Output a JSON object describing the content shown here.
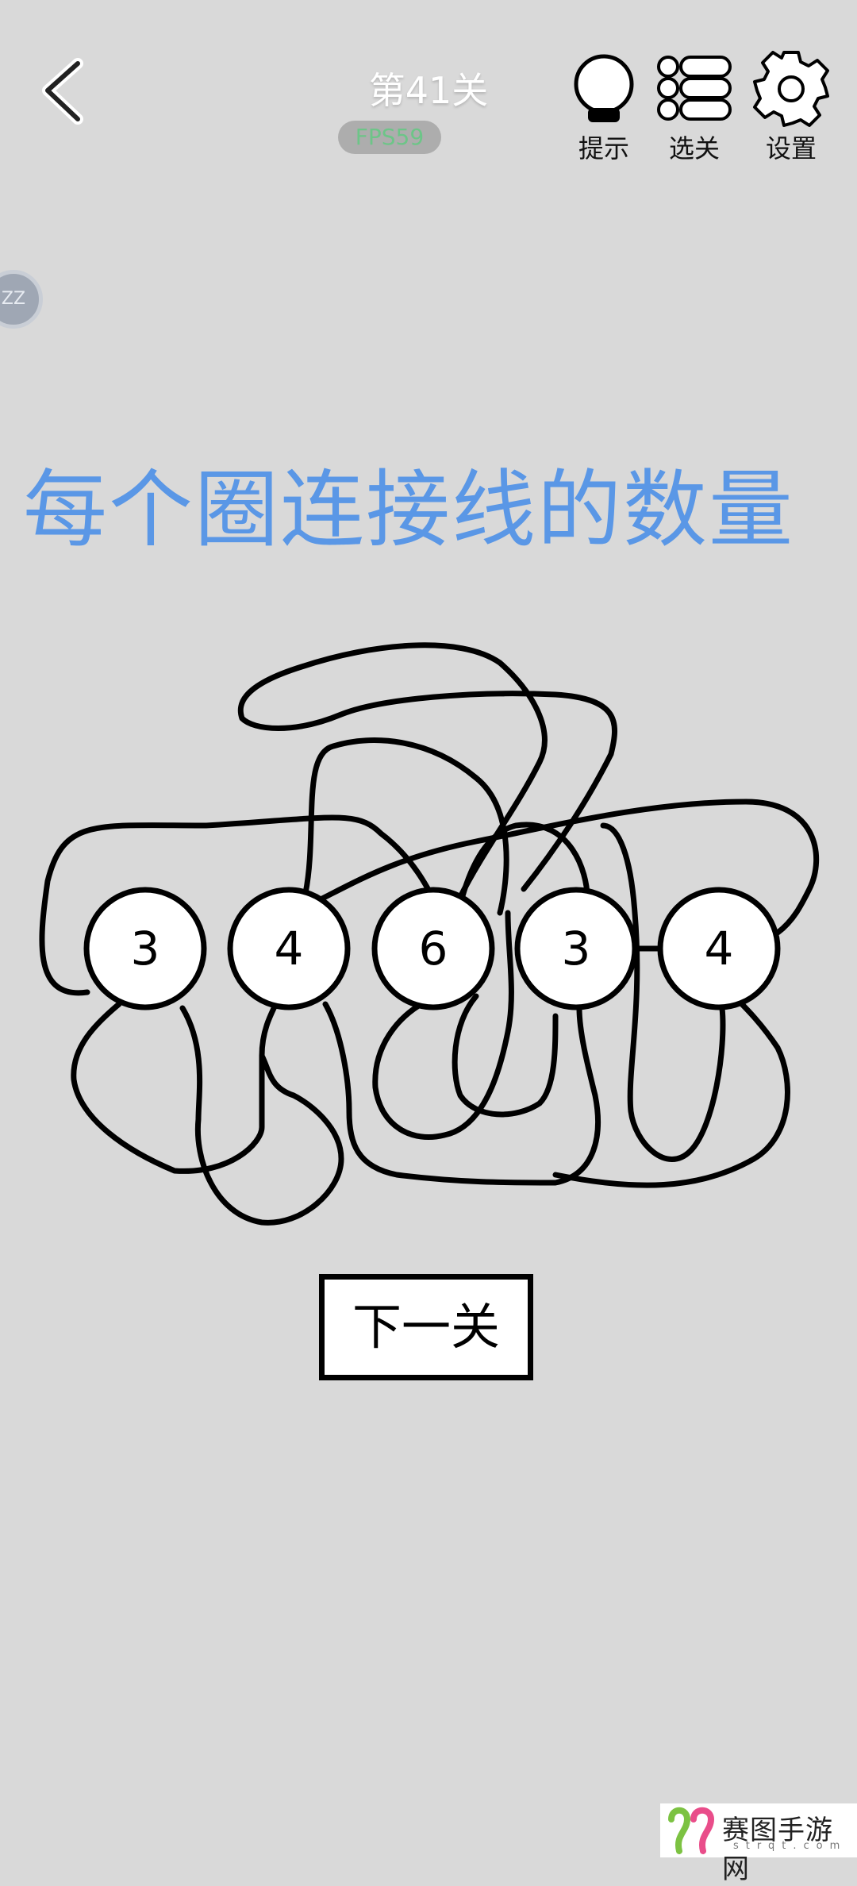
{
  "header": {
    "level_title": "第41关",
    "fps": "FPS59",
    "hint_label": "提示",
    "levels_label": "选关",
    "settings_label": "设置"
  },
  "side_bubble": "ZZ",
  "puzzle": {
    "title": "每个圈连接线的数量",
    "circles": [
      "3",
      "4",
      "6",
      "3",
      "4"
    ]
  },
  "next_button": "下一关",
  "watermark": {
    "text": "赛图手游网",
    "sub": "strqt.com"
  },
  "colors": {
    "background": "#d9d9d9",
    "title_blue": "#5a97e6",
    "line": "#000000",
    "circle_fill": "#ffffff"
  },
  "icons": [
    "back-chevron-icon",
    "lightbulb-icon",
    "level-list-icon",
    "gear-icon"
  ]
}
